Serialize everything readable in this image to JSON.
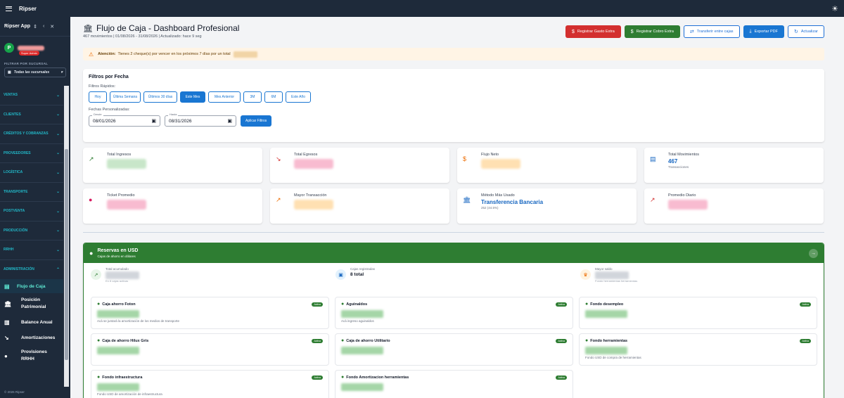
{
  "topbar": {
    "brand": "Ripser"
  },
  "sidebar": {
    "app_name": "Ripser App",
    "avatar_letter": "P",
    "role": "Super Admin",
    "filter_label": "FILTRAR POR SUCURSAL",
    "branch": "Todas las sucursales",
    "groups": [
      "VENTAS",
      "CLIENTES",
      "CRÉDITOS Y COBRANZAS",
      "PROVEEDORES",
      "LOGÍSTICA",
      "TRANSPORTE",
      "POSTVENTA",
      "PRODUCCIÓN",
      "RRHH",
      "ADMINISTRACIÓN"
    ],
    "subitems": [
      {
        "label": "Flujo de Caja",
        "icon": "cash-flow-icon",
        "active": true
      },
      {
        "label": "Posición Patrimonial",
        "icon": "bank-icon"
      },
      {
        "label": "Balance Anual",
        "icon": "chart-icon"
      },
      {
        "label": "Amortizaciones",
        "icon": "trend-icon"
      },
      {
        "label": "Provisiones RRHH",
        "icon": "piggy-icon"
      }
    ],
    "footer": "© 2026 Ripser"
  },
  "header": {
    "title": "Flujo de Caja - Dashboard Profesional",
    "subtitle": "467 movimientos | 01/08/2026 - 31/08/2026 | Actualizado: hace 9 seg",
    "buttons": {
      "expense": "Registrar Gasto Extra",
      "income": "Registrar Cobro Extra",
      "transfer": "Transferir entre cajas",
      "export": "Exportar PDF",
      "refresh": "Actualizar"
    }
  },
  "alert": {
    "strong": "Atención:",
    "text": "Tienes 2 cheque(s) por vencer en los próximos 7 días por un total"
  },
  "filters": {
    "title": "Filtros por Fecha",
    "quick_label": "Filtros Rápidos:",
    "quick": [
      "Hoy",
      "Última Semana",
      "Últimos 30 días",
      "Este Mes",
      "Mes Anterior",
      "3M",
      "6M",
      "Este Año"
    ],
    "active_quick": "Este Mes",
    "custom_label": "Fechas Personalizadas:",
    "from_label": "Desde",
    "from_value": "08/01/2026",
    "to_label": "Hasta",
    "to_value": "08/31/2026",
    "apply": "Aplicar Filtros"
  },
  "stats": [
    {
      "label": "Total Ingresos",
      "icon": "trend-up-icon",
      "color": "#2e7d32"
    },
    {
      "label": "Total Egresos",
      "icon": "trend-down-icon",
      "color": "#d32f2f"
    },
    {
      "label": "Flujo Neto",
      "icon": "dollar-icon",
      "color": "#ed6c02"
    },
    {
      "label": "Total Movimientos",
      "icon": "list-icon",
      "value": "467",
      "sub": "Transacciones",
      "color": "#1565c0"
    },
    {
      "label": "Ticket Promedio",
      "icon": "coin-icon",
      "color": "#d81b60"
    },
    {
      "label": "Mayor Transacción",
      "icon": "trend-up-icon",
      "color": "#ed6c02"
    },
    {
      "label": "Método Más Usado",
      "icon": "bank-icon",
      "value": "Transferencia Bancaria",
      "sub": "252 (44.5%)",
      "color": "#1565c0"
    },
    {
      "label": "Promedio Diario",
      "icon": "trend-icon",
      "color": "#d32f2f"
    }
  ],
  "reserve": {
    "title": "Reservas en USD",
    "subtitle": "Cajas de ahorro en dólares",
    "summary": [
      {
        "label": "Total acumulado",
        "caption": "En 8 cajas activas"
      },
      {
        "label": "Cajas registradas",
        "value": "8 total"
      },
      {
        "label": "Mayor saldo",
        "caption": "Fondo herramientas herramientas"
      }
    ],
    "badge": "Activa",
    "boxes": [
      {
        "name": "Caja ahorro Foton",
        "desc": "Acá se juntará la amortización de los medios de transporte"
      },
      {
        "name": "Aguinaldos",
        "desc": "Acá ingreso aguinaldos"
      },
      {
        "name": "Fondo desempleo",
        "desc": ""
      },
      {
        "name": "Caja de ahorro Hilux Gris",
        "desc": ""
      },
      {
        "name": "Caja de ahorro Utilitario",
        "desc": ""
      },
      {
        "name": "Fondo herramientas",
        "desc": "Fondo USD de compra de herramientas"
      },
      {
        "name": "Fondo infraestructura",
        "desc": "Fondo USD de amortización de infraestructura"
      },
      {
        "name": "Fondo Amortizacion herramientas",
        "desc": ""
      }
    ]
  }
}
